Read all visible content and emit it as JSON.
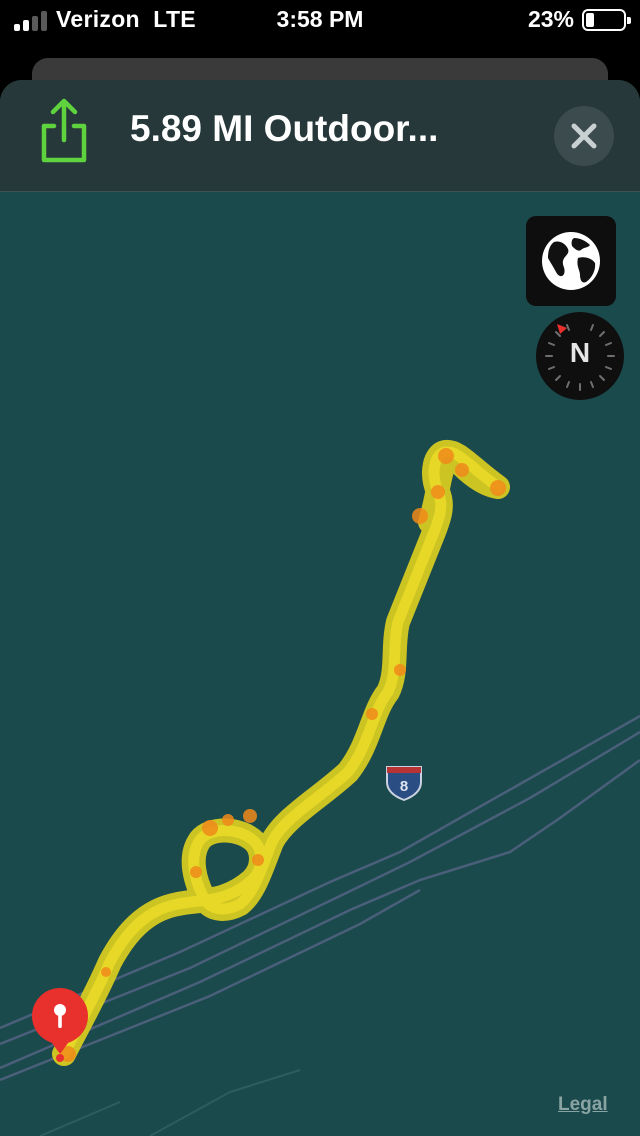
{
  "status_bar": {
    "carrier": "Verizon",
    "network": "LTE",
    "time": "3:58 PM",
    "battery_percent": "23%",
    "battery_level": 0.23,
    "signal_bars_active": 2,
    "signal_bars_total": 4
  },
  "sheet": {
    "title": "5.89 MI Outdoor...",
    "share_icon": "share-icon",
    "close_icon": "close-icon"
  },
  "map": {
    "globe_icon": "globe-icon",
    "compass_label": "N",
    "highway_shield": "8",
    "legal_link": "Legal",
    "pin_icon": "map-pin-icon"
  },
  "colors": {
    "background_map": "#1b4a4d",
    "route_yellow": "#e0d21a",
    "route_orange": "#f08a1a",
    "share_green": "#5fd33d",
    "pin_red": "#e8302c"
  }
}
